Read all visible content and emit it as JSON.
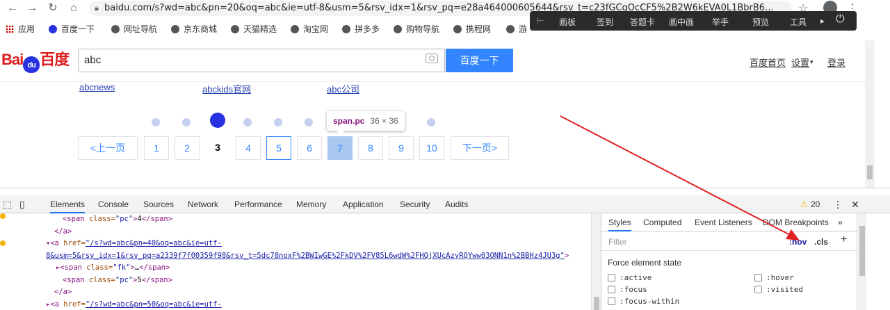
{
  "browser": {
    "url": "baidu.com/s?wd=abc&pn=20&oq=abc&ie=utf-8&usm=5&rsv_idx=1&rsv_pq=e28a464000605644&rsv_t=c23fGCqOcCF5%2B2W6kEVA0L1BbrB6...",
    "bookmarks": [
      "应用",
      "百度一下",
      "网址导航",
      "京东商城",
      "天猫精选",
      "淘宝网",
      "拼多多",
      "购物导航",
      "携程网",
      "游"
    ]
  },
  "recorder": {
    "items": [
      "画板",
      "签到",
      "答题卡",
      "画中画",
      "举手",
      "预览",
      "工具"
    ]
  },
  "header": {
    "logo": "Bai百度",
    "logo_du": "du",
    "search_value": "abc",
    "search_button": "百度一下",
    "links": [
      "百度首页",
      "设置",
      "登录"
    ]
  },
  "related": [
    "abcnews",
    "abckids官网",
    "abc公司"
  ],
  "pagination": {
    "prev": "<上一页",
    "pages": [
      "1",
      "2",
      "3",
      "4",
      "5",
      "6",
      "7",
      "8",
      "9",
      "10"
    ],
    "current": "3",
    "next": "下一页>"
  },
  "tooltip": {
    "tag": "span.pc",
    "size": "36 × 36"
  },
  "devtools": {
    "tabs": [
      "Elements",
      "Console",
      "Sources",
      "Network",
      "Performance",
      "Memory",
      "Application",
      "Security",
      "Audits"
    ],
    "warnings": "20",
    "code": {
      "line1_tag": "<span ",
      "line1_attr": "class=",
      "line1_val": "\"pc\"",
      "line1_text": "4",
      "line1_end": "</span>",
      "line2": "</a>",
      "line3_tag": "<a ",
      "line3_attr": "href=",
      "line3_link": "\"/s?wd=abc&pn=40&oq=abc&ie=utf-",
      "line4_link": "8&usm=5&rsv_idx=1&rsv_pq=a2339f7f00359f98&rsv_t=5dc78noxF%2BWIwGE%2FkDV%2FV85L6wdW%2FHQjXUcAzyRQYww03ONN1n%2BBHz4JU3g\"",
      "line4_end": ">",
      "line5_tag": "<span ",
      "line5_attr": "class=",
      "line5_val": "\"fk\"",
      "line5_text": "…",
      "line5_end": "</span>",
      "line6_tag": "<span ",
      "line6_attr": "class=",
      "line6_val": "\"pc\"",
      "line6_text": "5",
      "line6_end": "</span>",
      "line7": "</a>",
      "line8_tag": "<a ",
      "line8_attr": "href=",
      "line8_link": "\"/s?wd=abc&pn=50&oq=abc&ie=utf-"
    },
    "styles_tabs": [
      "Styles",
      "Computed",
      "Event Listeners",
      "DOM Breakpoints",
      "»"
    ],
    "filter_placeholder": "Filter",
    "hov": ":hov",
    "cls": ".cls",
    "plus": "+",
    "force_title": "Force element state",
    "states": [
      ":active",
      ":hover",
      ":focus",
      ":visited",
      ":focus-within"
    ]
  },
  "colors": {
    "accent": "#3385ff",
    "brand_red": "#de1d1d",
    "annotation_arrow": "#e02020"
  }
}
